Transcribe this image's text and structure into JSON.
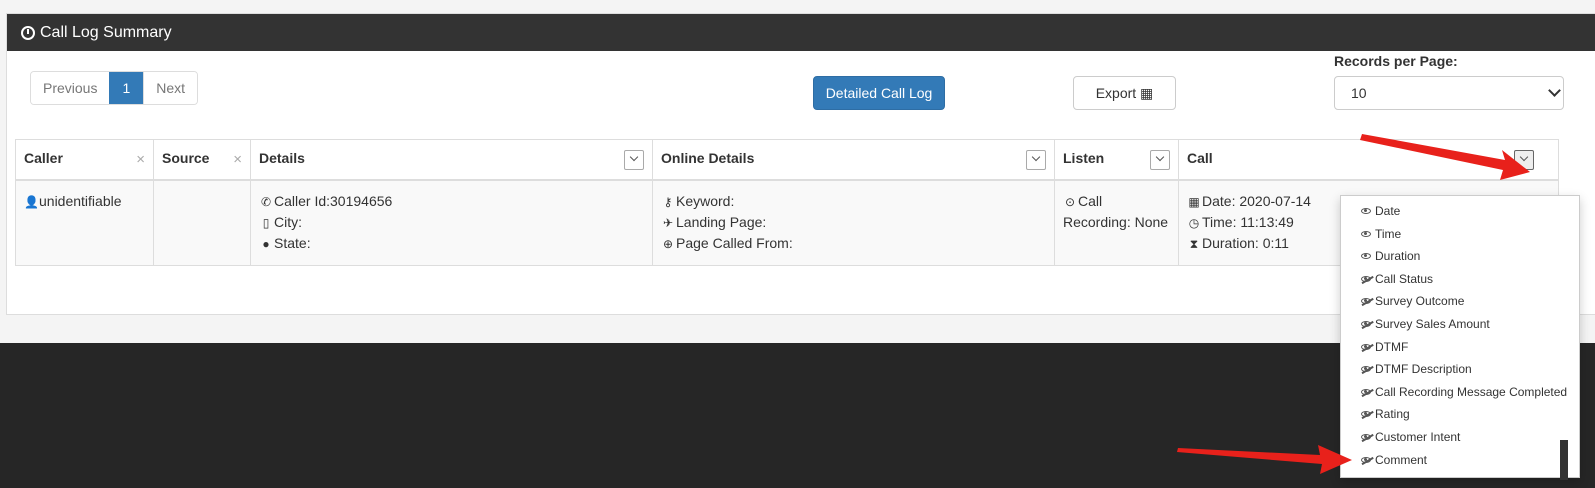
{
  "panel": {
    "title": "Call Log Summary"
  },
  "pagination": {
    "previous": "Previous",
    "current": "1",
    "next": "Next"
  },
  "toolbar": {
    "detailed_call_log": "Detailed Call Log",
    "export": "Export ▦"
  },
  "records_per_page": {
    "label": "Records per Page:",
    "value": "10"
  },
  "table": {
    "headers": [
      "Caller",
      "Source",
      "Details",
      "Online Details",
      "Listen",
      "Call"
    ],
    "row": {
      "caller": "unidentifiable",
      "source": "",
      "details": [
        "Caller Id:30194656",
        "City:",
        "State:"
      ],
      "online_details": [
        "Keyword:",
        "Landing Page:",
        "Page Called From:"
      ],
      "listen": [
        "Call",
        "Recording: None"
      ],
      "call": [
        "Date: 2020-07-14",
        "Time: 11:13:49",
        "Duration: 0:11"
      ]
    }
  },
  "column_menu": {
    "items": [
      {
        "label": "Date",
        "visible": true
      },
      {
        "label": "Time",
        "visible": true
      },
      {
        "label": "Duration",
        "visible": true
      },
      {
        "label": "Call Status",
        "visible": false
      },
      {
        "label": "Survey Outcome",
        "visible": false
      },
      {
        "label": "Survey Sales Amount",
        "visible": false
      },
      {
        "label": "DTMF",
        "visible": false
      },
      {
        "label": "DTMF Description",
        "visible": false
      },
      {
        "label": "Call Recording Message Completed",
        "visible": false
      },
      {
        "label": "Rating",
        "visible": false
      },
      {
        "label": "Customer Intent",
        "visible": false
      },
      {
        "label": "Comment",
        "visible": false
      }
    ]
  },
  "colors": {
    "header_bg": "#333333",
    "primary": "#337ab7",
    "annotation_arrow": "#e8211b",
    "footer_bg": "#262626"
  }
}
